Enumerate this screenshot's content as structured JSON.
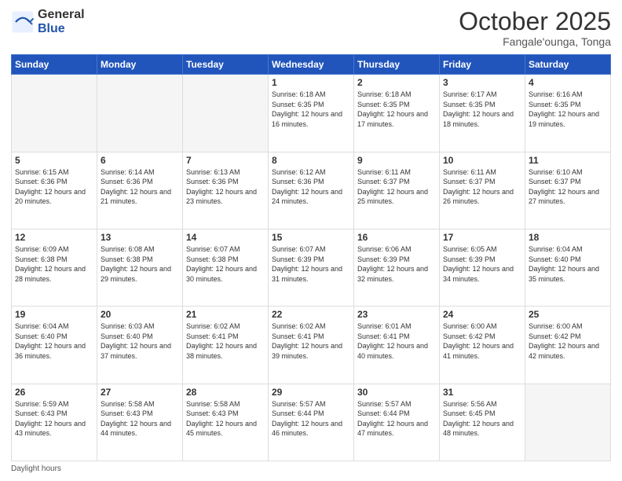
{
  "logo": {
    "general": "General",
    "blue": "Blue"
  },
  "title": "October 2025",
  "subtitle": "Fangale'ounga, Tonga",
  "footer": "Daylight hours",
  "days_header": [
    "Sunday",
    "Monday",
    "Tuesday",
    "Wednesday",
    "Thursday",
    "Friday",
    "Saturday"
  ],
  "weeks": [
    [
      {
        "num": "",
        "info": ""
      },
      {
        "num": "",
        "info": ""
      },
      {
        "num": "",
        "info": ""
      },
      {
        "num": "1",
        "info": "Sunrise: 6:18 AM\nSunset: 6:35 PM\nDaylight: 12 hours and 16 minutes."
      },
      {
        "num": "2",
        "info": "Sunrise: 6:18 AM\nSunset: 6:35 PM\nDaylight: 12 hours and 17 minutes."
      },
      {
        "num": "3",
        "info": "Sunrise: 6:17 AM\nSunset: 6:35 PM\nDaylight: 12 hours and 18 minutes."
      },
      {
        "num": "4",
        "info": "Sunrise: 6:16 AM\nSunset: 6:35 PM\nDaylight: 12 hours and 19 minutes."
      }
    ],
    [
      {
        "num": "5",
        "info": "Sunrise: 6:15 AM\nSunset: 6:36 PM\nDaylight: 12 hours and 20 minutes."
      },
      {
        "num": "6",
        "info": "Sunrise: 6:14 AM\nSunset: 6:36 PM\nDaylight: 12 hours and 21 minutes."
      },
      {
        "num": "7",
        "info": "Sunrise: 6:13 AM\nSunset: 6:36 PM\nDaylight: 12 hours and 23 minutes."
      },
      {
        "num": "8",
        "info": "Sunrise: 6:12 AM\nSunset: 6:36 PM\nDaylight: 12 hours and 24 minutes."
      },
      {
        "num": "9",
        "info": "Sunrise: 6:11 AM\nSunset: 6:37 PM\nDaylight: 12 hours and 25 minutes."
      },
      {
        "num": "10",
        "info": "Sunrise: 6:11 AM\nSunset: 6:37 PM\nDaylight: 12 hours and 26 minutes."
      },
      {
        "num": "11",
        "info": "Sunrise: 6:10 AM\nSunset: 6:37 PM\nDaylight: 12 hours and 27 minutes."
      }
    ],
    [
      {
        "num": "12",
        "info": "Sunrise: 6:09 AM\nSunset: 6:38 PM\nDaylight: 12 hours and 28 minutes."
      },
      {
        "num": "13",
        "info": "Sunrise: 6:08 AM\nSunset: 6:38 PM\nDaylight: 12 hours and 29 minutes."
      },
      {
        "num": "14",
        "info": "Sunrise: 6:07 AM\nSunset: 6:38 PM\nDaylight: 12 hours and 30 minutes."
      },
      {
        "num": "15",
        "info": "Sunrise: 6:07 AM\nSunset: 6:39 PM\nDaylight: 12 hours and 31 minutes."
      },
      {
        "num": "16",
        "info": "Sunrise: 6:06 AM\nSunset: 6:39 PM\nDaylight: 12 hours and 32 minutes."
      },
      {
        "num": "17",
        "info": "Sunrise: 6:05 AM\nSunset: 6:39 PM\nDaylight: 12 hours and 34 minutes."
      },
      {
        "num": "18",
        "info": "Sunrise: 6:04 AM\nSunset: 6:40 PM\nDaylight: 12 hours and 35 minutes."
      }
    ],
    [
      {
        "num": "19",
        "info": "Sunrise: 6:04 AM\nSunset: 6:40 PM\nDaylight: 12 hours and 36 minutes."
      },
      {
        "num": "20",
        "info": "Sunrise: 6:03 AM\nSunset: 6:40 PM\nDaylight: 12 hours and 37 minutes."
      },
      {
        "num": "21",
        "info": "Sunrise: 6:02 AM\nSunset: 6:41 PM\nDaylight: 12 hours and 38 minutes."
      },
      {
        "num": "22",
        "info": "Sunrise: 6:02 AM\nSunset: 6:41 PM\nDaylight: 12 hours and 39 minutes."
      },
      {
        "num": "23",
        "info": "Sunrise: 6:01 AM\nSunset: 6:41 PM\nDaylight: 12 hours and 40 minutes."
      },
      {
        "num": "24",
        "info": "Sunrise: 6:00 AM\nSunset: 6:42 PM\nDaylight: 12 hours and 41 minutes."
      },
      {
        "num": "25",
        "info": "Sunrise: 6:00 AM\nSunset: 6:42 PM\nDaylight: 12 hours and 42 minutes."
      }
    ],
    [
      {
        "num": "26",
        "info": "Sunrise: 5:59 AM\nSunset: 6:43 PM\nDaylight: 12 hours and 43 minutes."
      },
      {
        "num": "27",
        "info": "Sunrise: 5:58 AM\nSunset: 6:43 PM\nDaylight: 12 hours and 44 minutes."
      },
      {
        "num": "28",
        "info": "Sunrise: 5:58 AM\nSunset: 6:43 PM\nDaylight: 12 hours and 45 minutes."
      },
      {
        "num": "29",
        "info": "Sunrise: 5:57 AM\nSunset: 6:44 PM\nDaylight: 12 hours and 46 minutes."
      },
      {
        "num": "30",
        "info": "Sunrise: 5:57 AM\nSunset: 6:44 PM\nDaylight: 12 hours and 47 minutes."
      },
      {
        "num": "31",
        "info": "Sunrise: 5:56 AM\nSunset: 6:45 PM\nDaylight: 12 hours and 48 minutes."
      },
      {
        "num": "",
        "info": ""
      }
    ]
  ]
}
